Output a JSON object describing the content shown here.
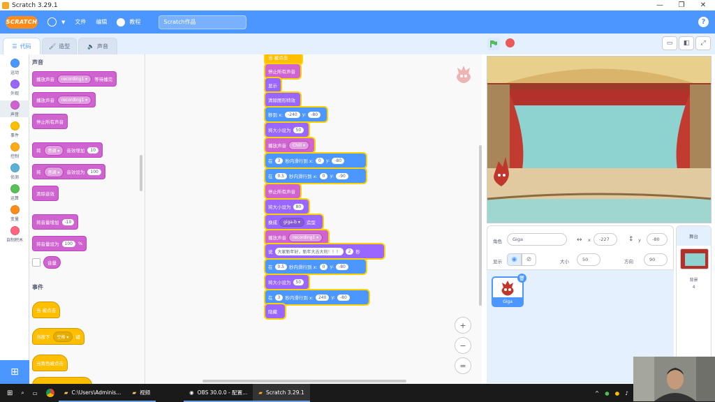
{
  "window": {
    "title": "Scratch 3.29.1",
    "minimize": "—",
    "restore": "❐",
    "close": "✕"
  },
  "menubar": {
    "logo": "SCRATCH",
    "file": "文件",
    "edit": "编辑",
    "tutorials": "教程",
    "project_title": "Scratch作品",
    "help": "?"
  },
  "tabs": {
    "code": "代码",
    "costumes": "造型",
    "sounds": "声音"
  },
  "categories": [
    {
      "label": "运动",
      "color": "#4c97ff"
    },
    {
      "label": "外观",
      "color": "#9966ff"
    },
    {
      "label": "声音",
      "color": "#cf63cf"
    },
    {
      "label": "事件",
      "color": "#ffbf00"
    },
    {
      "label": "控制",
      "color": "#ffab19"
    },
    {
      "label": "侦测",
      "color": "#5cb1d6"
    },
    {
      "label": "运算",
      "color": "#59c059"
    },
    {
      "label": "变量",
      "color": "#ff8c1a"
    },
    {
      "label": "自制积木",
      "color": "#ff6680"
    }
  ],
  "palette": {
    "sound_title": "声音",
    "play_until_done": {
      "pre": "播放声音",
      "drop": "recording1 ▾",
      "post": "等待播完"
    },
    "start_sound": {
      "pre": "播放声音",
      "drop": "recording1 ▾"
    },
    "stop_all_sounds": "停止所有声音",
    "change_effect": {
      "pre": "将",
      "drop": "音调 ▾",
      "mid": "音效增加",
      "val": "10"
    },
    "set_effect": {
      "pre": "将",
      "drop": "音调 ▾",
      "mid": "音效设为",
      "val": "100"
    },
    "clear_effects": "清除音效",
    "change_volume": {
      "pre": "将音量增加",
      "val": "-10"
    },
    "set_volume": {
      "pre": "将音量设为",
      "val": "100",
      "unit": "%"
    },
    "volume_reporter": "音量",
    "events_title": "事件",
    "when_flag": "当 被点击",
    "when_key": {
      "pre": "当按下",
      "drop": "空格 ▾",
      "post": "键"
    },
    "when_sprite_clicked": "当角色被点击"
  },
  "script": {
    "top_partial": "当 被点击",
    "b1": "停止所有声音",
    "b2": "显示",
    "b3": "清除图形特效",
    "b4": {
      "pre": "移到 x:",
      "x": "-240",
      "mid": "y:",
      "y": "-80"
    },
    "b5": {
      "pre": "将大小设为",
      "val": "50"
    },
    "b6": {
      "pre": "播放声音",
      "drop": "Chill ▾"
    },
    "b7": {
      "pre": "在",
      "t": "3",
      "mid": "秒内滑行到 x:",
      "x": "0",
      "mid2": "y:",
      "y": "-80"
    },
    "b8": {
      "pre": "在",
      "t": "0.5",
      "mid": "秒内滑行到 x:",
      "x": "0",
      "mid2": "y:",
      "y": "-90"
    },
    "b9": "停止所有声音",
    "b10": {
      "pre": "将大小设为",
      "val": "80"
    },
    "b11": {
      "pre": "换成",
      "drop": "giga-b ▾",
      "post": "造型"
    },
    "b12": {
      "pre": "播放声音",
      "drop": "recording1 ▾"
    },
    "b13": {
      "pre": "说",
      "text": "大家新年好，新年大吉大利！！！",
      "secs": "2",
      "post": "秒"
    },
    "b14": {
      "pre": "在",
      "t": "0.5",
      "mid": "秒内滑行到 x:",
      "x": "0",
      "mid2": "y:",
      "y": "-80"
    },
    "b15": {
      "pre": "将大小设为",
      "val": "50"
    },
    "b16": {
      "pre": "在",
      "t": "3",
      "mid": "秒内滑行到 x:",
      "x": "240",
      "mid2": "y:",
      "y": "-80"
    },
    "b17": "隐藏"
  },
  "zoom": {
    "in": "+",
    "out": "−",
    "reset": "="
  },
  "sprite_info": {
    "sprite_label": "角色",
    "sprite_name": "Giga",
    "x_label": "x",
    "x_val": "-227",
    "y_label": "y",
    "y_val": "-80",
    "show_label": "显示",
    "size_label": "大小",
    "size_val": "50",
    "dir_label": "方向",
    "dir_val": "90"
  },
  "sprites": [
    {
      "name": "Giga"
    }
  ],
  "stage_pane": {
    "title": "舞台",
    "backdrops_label": "背景",
    "backdrops_count": "4"
  },
  "taskbar": {
    "explorer": "C:\\Users\\Adminis...",
    "video": "视频",
    "obs": "OBS 30.0.0 - 配置...",
    "scratch": "Scratch 3.29.1"
  }
}
